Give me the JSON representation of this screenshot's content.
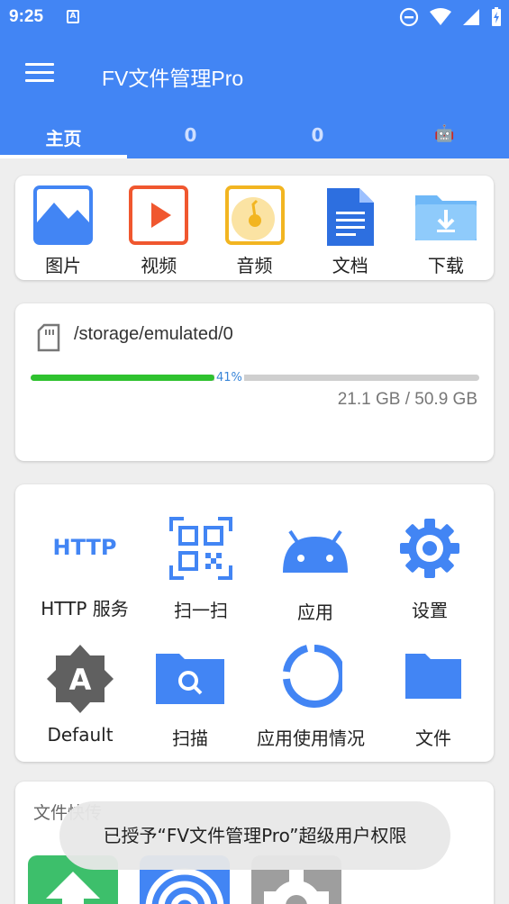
{
  "status": {
    "time": "9:25",
    "notif_badge": "A"
  },
  "app": {
    "title": "FV文件管理Pro",
    "accent": "#4285f4"
  },
  "tabs": [
    {
      "label": "主页",
      "active": true
    },
    {
      "label": "0",
      "active": false
    },
    {
      "label": "0",
      "active": false
    },
    {
      "label": "🤖",
      "active": false
    }
  ],
  "categories": [
    {
      "label": "图片",
      "icon": "image-icon"
    },
    {
      "label": "视频",
      "icon": "video-icon"
    },
    {
      "label": "音频",
      "icon": "audio-icon"
    },
    {
      "label": "文档",
      "icon": "document-icon"
    },
    {
      "label": "下载",
      "icon": "download-folder-icon"
    }
  ],
  "storage": {
    "path": "/storage/emulated/0",
    "used_percent": 41,
    "percent_label": "41%",
    "size_text": "21.1 GB  /  50.9 GB"
  },
  "tools": [
    {
      "label": "HTTP 服务",
      "icon": "http-icon",
      "icon_text": "HTTP"
    },
    {
      "label": "扫一扫",
      "icon": "qr-code-icon"
    },
    {
      "label": "应用",
      "icon": "android-icon"
    },
    {
      "label": "设置",
      "icon": "gear-icon"
    },
    {
      "label": "Default",
      "icon": "theme-icon",
      "icon_text": "A"
    },
    {
      "label": "扫描",
      "icon": "search-folder-icon"
    },
    {
      "label": "应用使用情况",
      "icon": "usage-ring-icon"
    },
    {
      "label": "文件",
      "icon": "folder-icon"
    }
  ],
  "quick_transfer": {
    "title": "文件快传"
  },
  "toast": {
    "text": "已授予“FV文件管理Pro”超级用户权限"
  }
}
